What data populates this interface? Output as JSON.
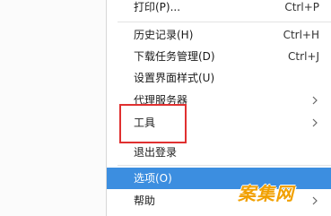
{
  "menu": {
    "items": [
      {
        "label": "打印(P)...",
        "shortcut": "Ctrl+P"
      },
      {
        "label": "历史记录(H)",
        "shortcut": "Ctrl+H"
      },
      {
        "label": "下载任务管理(D)",
        "shortcut": "Ctrl+J"
      },
      {
        "label": "设置界面样式(U)"
      },
      {
        "label": "代理服务器",
        "submenu_icon": "chevron-right-icon"
      },
      {
        "label": "工具",
        "submenu_icon": "chevron-right-icon"
      },
      {
        "label": "退出登录"
      },
      {
        "label": "选项(O)",
        "state": "highlighted"
      },
      {
        "label": "帮助",
        "submenu_icon": "chevron-right-icon"
      }
    ]
  },
  "annotation": {
    "color": "#e03030",
    "target": "工具"
  },
  "colors": {
    "highlight": "#3c8ee0",
    "watermark": "#f1a000"
  },
  "watermark": {
    "text": "案集网"
  }
}
